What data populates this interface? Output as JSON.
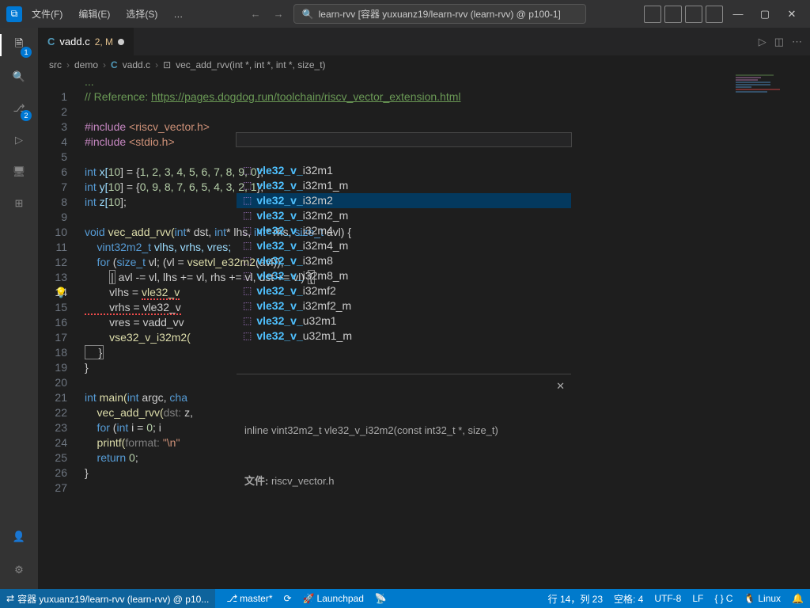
{
  "menu": {
    "file": "文件(F)",
    "edit": "编辑(E)",
    "select": "选择(S)"
  },
  "search": {
    "text": "learn-rvv [容器 yuxuanz19/learn-rvv (learn-rvv) @ p100-1]"
  },
  "tab": {
    "name": "vadd.c",
    "status": "2, M"
  },
  "breadcrumb": {
    "p1": "src",
    "p2": "demo",
    "p3": "vadd.c",
    "p4": "vec_add_rvv(int *, int *, int *, size_t)"
  },
  "activity": {
    "explorer_badge": "1",
    "scm_badge": "2"
  },
  "code": {
    "l0": "...",
    "l1_a": "// Reference: ",
    "l1_b": "https://pages.dogdog.run/toolchain/riscv_vector_extension.html",
    "l3": "#include ",
    "l3i": "<riscv_vector.h>",
    "l4": "#include ",
    "l4i": "<stdio.h>",
    "l6a": "int",
    "l6b": " x[",
    "l6n": "10",
    "l6c": "] = {",
    "l6arr": "1, 2, 3, 4, 5, 6, 7, 8, 9, 0",
    "l6e": "};",
    "l7a": "int",
    "l7b": " y[",
    "l7c": "] = {",
    "l7arr": "0, 9, 8, 7, 6, 5, 4, 3, 2, 1",
    "l7e": "};",
    "l8a": "int",
    "l8b": " z[",
    "l8e": "];",
    "l10a": "void",
    "l10b": " vec_add_rvv(",
    "l10c": "int",
    "l10d": "* dst, ",
    "l10e": "int",
    "l10f": "* lhs, ",
    "l10g": "int",
    "l10h": "* rhs, ",
    "l10i": "size_t",
    "l10j": " avl) {",
    "l11a": "    vint32m2_t",
    "l11b": " vlhs, vrhs, vres;",
    "l12a": "    for",
    "l12b": " (",
    "l12c": "size_t",
    "l12d": " vl; (vl = ",
    "l12e": "vsetvl_e32m2",
    "l12f": "(avl));",
    "l13a": "        ",
    "l13b": " avl -= vl, lhs += vl, rhs += vl, dst += vl) ",
    "l14a": "        vlhs = ",
    "l14b": "vle32_v",
    "l15a": "        vrhs = vle32_v",
    "l16a": "        vres = vadd_vv",
    "l17a": "        vse32_v_i32m2(",
    "l18": "    }",
    "l19": "}",
    "l21a": "int",
    "l21b": " main(",
    "l21c": "int",
    "l21d": " argc, ",
    "l21e": "cha",
    "l22a": "    vec_add_rvv(",
    "l22p": "dst:",
    "l22b": " z,",
    "l23a": "    for",
    "l23b": " (",
    "l23c": "int",
    "l23d": " i = ",
    "l23n": "0",
    "l23e": "; i",
    "l24a": "    printf(",
    "l24p": "format:",
    "l24s": " \"\\n\"",
    "l25a": "    return",
    "l25b": " 0",
    "l26": "}"
  },
  "suggest": {
    "items": [
      {
        "m": "vle32_v_",
        "r": "i32m1"
      },
      {
        "m": "vle32_v_",
        "r": "i32m1_m"
      },
      {
        "m": "vle32_v_",
        "r": "i32m2"
      },
      {
        "m": "vle32_v_",
        "r": "i32m2_m"
      },
      {
        "m": "vle32_v_",
        "r": "i32m4"
      },
      {
        "m": "vle32_v_",
        "r": "i32m4_m"
      },
      {
        "m": "vle32_v_",
        "r": "i32m8"
      },
      {
        "m": "vle32_v_",
        "r": "i32m8_m"
      },
      {
        "m": "vle32_v_",
        "r": "i32mf2"
      },
      {
        "m": "vle32_v_",
        "r": "i32mf2_m"
      },
      {
        "m": "vle32_v_",
        "r": "u32m1"
      },
      {
        "m": "vle32_v_",
        "r": "u32m1_m"
      }
    ],
    "detail": "inline vint32m2_t vle32_v_i32m2(const int32_t *, size_t)",
    "file_label": "文件:",
    "file": "riscv_vector.h"
  },
  "status": {
    "remote": "容器 yuxuanz19/learn-rvv (learn-rvv) @ p10...",
    "branch": "master*",
    "launchpad": "Launchpad",
    "pos": "行 14，列 23",
    "spaces": "空格: 4",
    "enc": "UTF-8",
    "eol": "LF",
    "lang": "C",
    "os": "Linux"
  }
}
